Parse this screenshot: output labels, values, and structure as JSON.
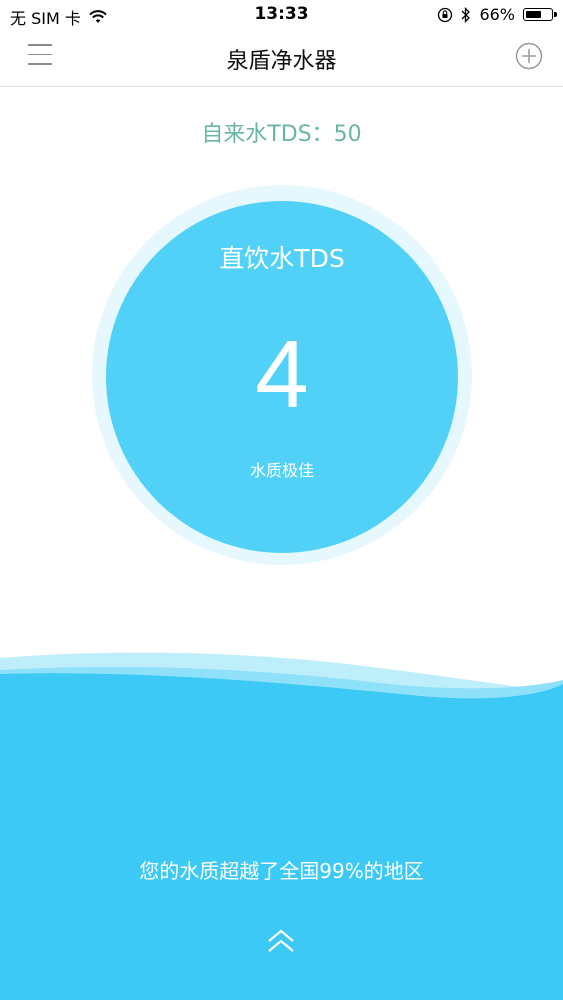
{
  "status_bar": {
    "carrier": "无 SIM 卡",
    "time": "13:33",
    "battery_percent": "66%",
    "battery_level": 0.66,
    "icons": [
      "wifi-icon",
      "orientation-lock-icon",
      "bluetooth-icon",
      "battery-icon"
    ]
  },
  "nav": {
    "title": "泉盾净水器",
    "left_icon": "menu-icon",
    "right_icon": "add-icon"
  },
  "tap_water": {
    "label": "自来水TDS：50"
  },
  "drinking_water": {
    "label": "直饮水TDS",
    "value": "4",
    "quality": "水质极佳"
  },
  "comparison": {
    "text": "您的水质超越了全国99%的地区"
  },
  "colors": {
    "circle": "#52d1f8",
    "water": "#3dc9f6",
    "tap_label": "#69b6a6"
  }
}
